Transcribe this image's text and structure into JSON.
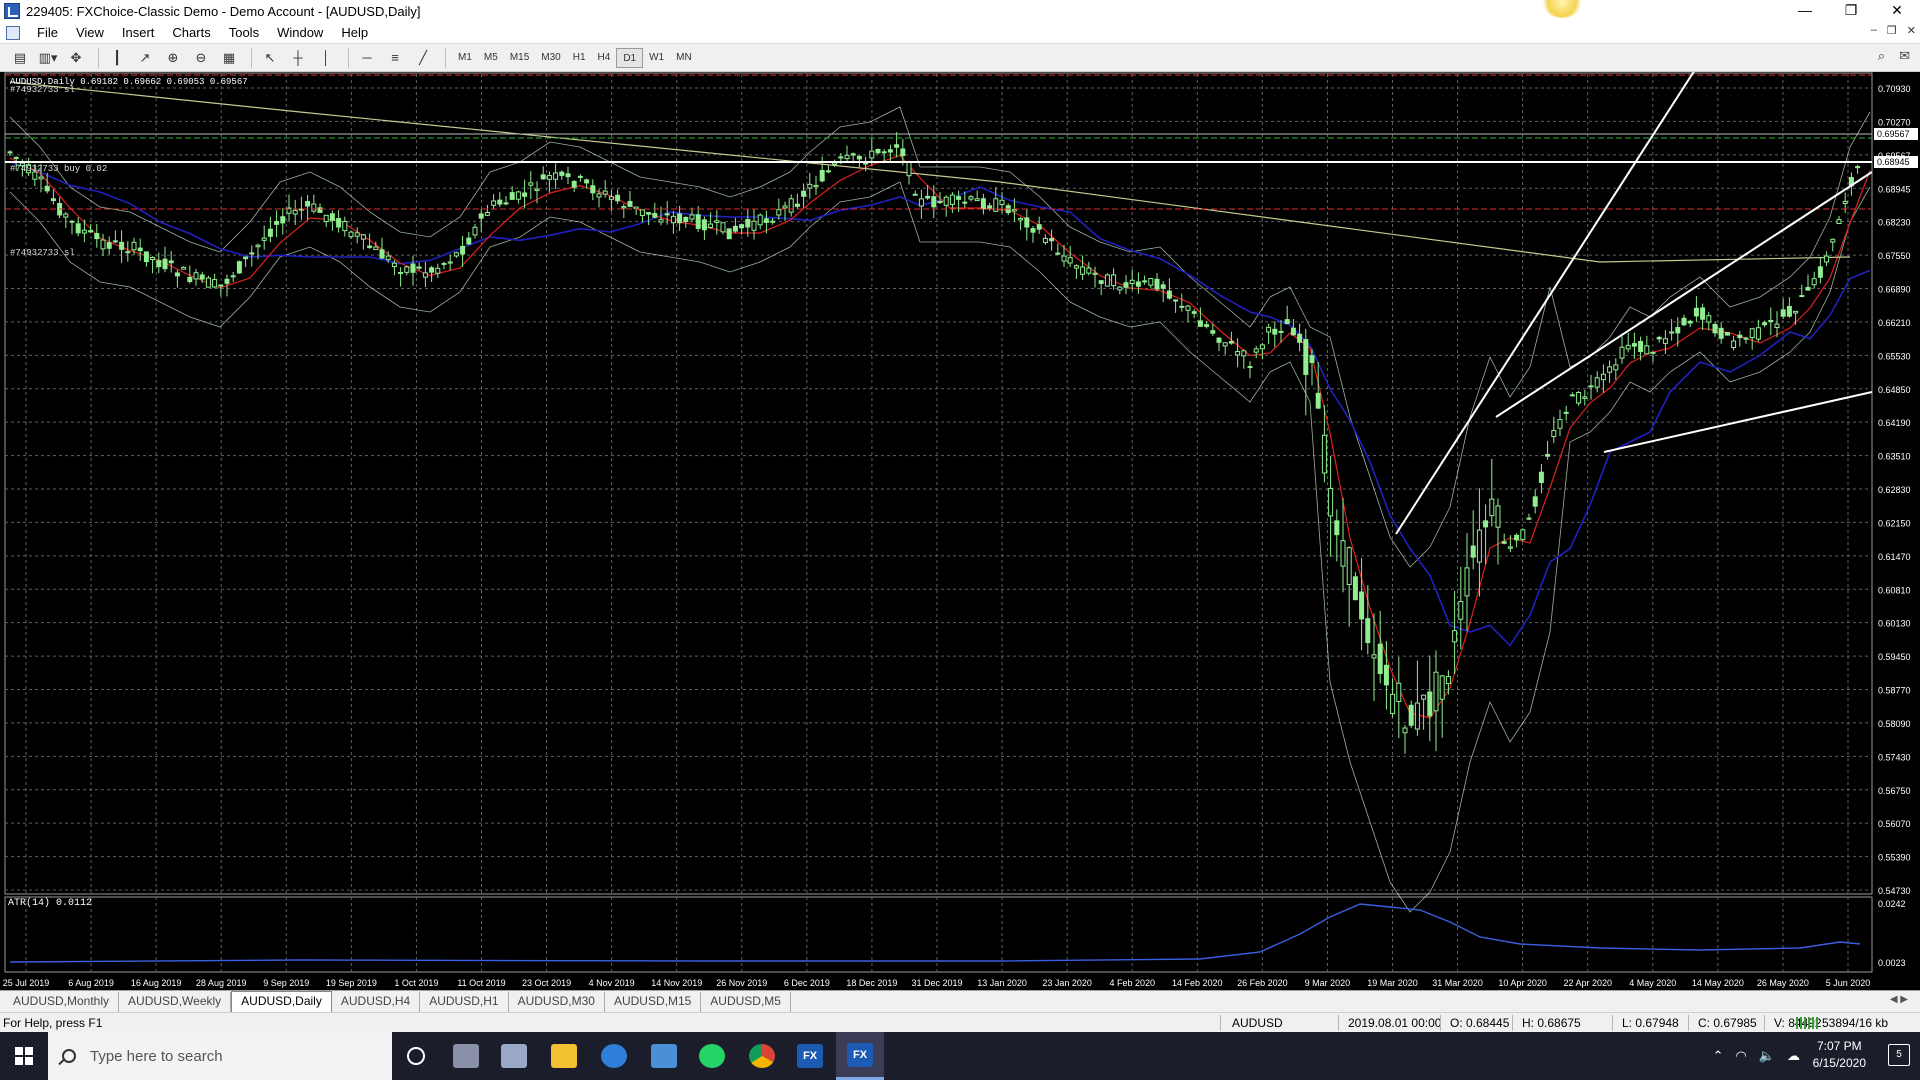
{
  "window": {
    "title": "229405: FXChoice-Classic Demo - Demo Account - [AUDUSD,Daily]",
    "controls": {
      "minimize": "—",
      "maximize": "❐",
      "close": "✕"
    }
  },
  "menu": {
    "items": [
      "File",
      "View",
      "Insert",
      "Charts",
      "Tools",
      "Window",
      "Help"
    ]
  },
  "toolbar": {
    "timeframes": [
      "M1",
      "M5",
      "M15",
      "M30",
      "H1",
      "H4",
      "D1",
      "W1",
      "MN"
    ],
    "active_timeframe": "D1"
  },
  "chart": {
    "header": "AUDUSD,Daily  0.69182 0.69662 0.69053 0.69567",
    "order_label_top": "#74932733 sl",
    "order_label_buy": "#74932733 buy 0.02",
    "order_label_sl": "#74932733 sl",
    "indicator_label": "ATR(14) 0.0112",
    "price_labels": [
      "0.70930",
      "0.70270",
      "0.69567",
      "0.68945",
      "0.68230",
      "0.67550",
      "0.66890",
      "0.66210",
      "0.65530",
      "0.64850",
      "0.64190",
      "0.63510",
      "0.62830",
      "0.62150",
      "0.61470",
      "0.60810",
      "0.60130",
      "0.59450",
      "0.58770",
      "0.58090",
      "0.57430",
      "0.56750",
      "0.56070",
      "0.55390",
      "0.54730"
    ],
    "current_price_label": "0.69567",
    "line_price_label": "0.68945",
    "atr_scale_labels": [
      "0.0242",
      "0.0023"
    ],
    "date_labels": [
      "25 Jul 2019",
      "6 Aug 2019",
      "16 Aug 2019",
      "28 Aug 2019",
      "9 Sep 2019",
      "19 Sep 2019",
      "1 Oct 2019",
      "11 Oct 2019",
      "23 Oct 2019",
      "4 Nov 2019",
      "14 Nov 2019",
      "26 Nov 2019",
      "6 Dec 2019",
      "18 Dec 2019",
      "31 Dec 2019",
      "13 Jan 2020",
      "23 Jan 2020",
      "4 Feb 2020",
      "14 Feb 2020",
      "26 Feb 2020",
      "9 Mar 2020",
      "19 Mar 2020",
      "31 Mar 2020",
      "10 Apr 2020",
      "22 Apr 2020",
      "4 May 2020",
      "14 May 2020",
      "26 May 2020",
      "5 Jun 2020"
    ],
    "colors": {
      "bull": "#90ee90",
      "bear": "#90ee90",
      "ma_fast": "#e02020",
      "ma_slow": "#2020c0",
      "ma_long": "#c8c890",
      "grid": "#606060",
      "bands": "#d8ffd8"
    }
  },
  "chart_tabs": {
    "items": [
      "AUDUSD,Monthly",
      "AUDUSD,Weekly",
      "AUDUSD,Daily",
      "AUDUSD,H4",
      "AUDUSD,H1",
      "AUDUSD,M30",
      "AUDUSD,M15",
      "AUDUSD,M5"
    ],
    "active": "AUDUSD,Daily"
  },
  "status": {
    "help": "For Help, press F1",
    "symbol": "AUDUSD",
    "datetime": "2019.08.01 00:00",
    "open": "O: 0.68445",
    "high": "H: 0.68675",
    "low": "L: 0.67948",
    "close": "C: 0.67985",
    "volume": "V: 84492",
    "traffic": "53894/16 kb"
  },
  "taskbar": {
    "search_placeholder": "Type here to search",
    "time": "7:07 PM",
    "date": "6/15/2020",
    "notifications": "5"
  }
}
